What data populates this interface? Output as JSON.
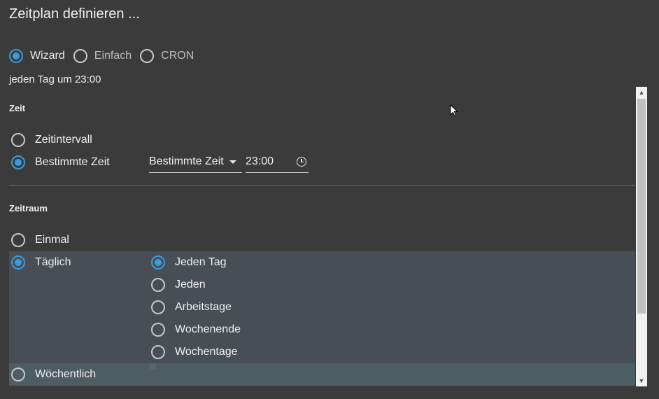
{
  "title": "Zeitplan definieren ...",
  "modes": [
    {
      "label": "Wizard",
      "checked": true
    },
    {
      "label": "Einfach",
      "checked": false
    },
    {
      "label": "CRON",
      "checked": false
    }
  ],
  "summary": "jeden Tag um 23:00",
  "time_section": {
    "heading": "Zeit",
    "options": [
      {
        "label": "Zeitintervall",
        "checked": false
      },
      {
        "label": "Bestimmte Zeit",
        "checked": true
      }
    ],
    "select_value": "Bestimmte Zeit",
    "time_value": "23:00"
  },
  "period_section": {
    "heading": "Zeitraum",
    "options": [
      {
        "label": "Einmal",
        "checked": false
      },
      {
        "label": "Täglich",
        "checked": true
      },
      {
        "label": "Wöchentlich",
        "checked": false
      }
    ],
    "daily_options": [
      {
        "label": "Jeden Tag",
        "checked": true
      },
      {
        "label": "Jeden",
        "checked": false
      },
      {
        "label": "Arbeitstage",
        "checked": false
      },
      {
        "label": "Wochenende",
        "checked": false
      },
      {
        "label": "Wochentage",
        "checked": false
      }
    ]
  },
  "colors": {
    "background": "#3b3b3b",
    "accent": "#3d9bd8",
    "daily_highlight": "#474e56",
    "weekly_highlight": "#4c5d63"
  }
}
